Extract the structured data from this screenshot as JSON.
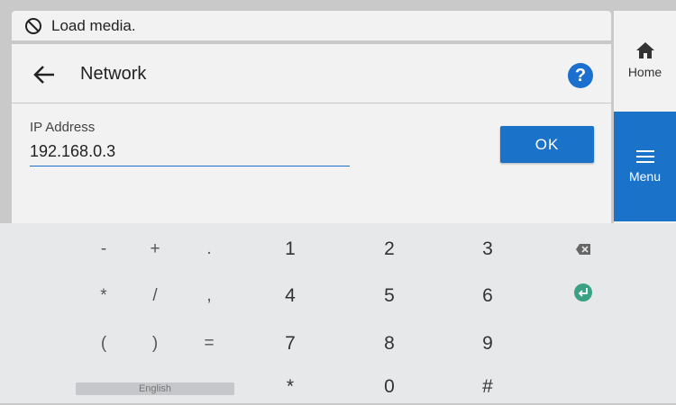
{
  "status": {
    "icon": "no-media-icon",
    "text": "Load media."
  },
  "header": {
    "title": "Network",
    "back_icon": "arrow-left-icon",
    "help_icon": "help-icon",
    "help_symbol": "?"
  },
  "form": {
    "label": "IP Address",
    "value": "192.168.0.3",
    "ok_label": "OK"
  },
  "sidebar": {
    "home": {
      "icon": "home-icon",
      "label": "Home"
    },
    "menu": {
      "icon": "hamburger-icon",
      "label": "Menu"
    }
  },
  "keyboard": {
    "language": "English",
    "symbols": [
      "-",
      "+",
      ".",
      "*",
      "/",
      ",",
      "(",
      ")",
      "="
    ],
    "numbers": [
      "1",
      "2",
      "3",
      "4",
      "5",
      "6",
      "7",
      "8",
      "9",
      "*",
      "0",
      "#"
    ]
  },
  "colors": {
    "accent": "#1a72c9",
    "enter_key": "#3aa184"
  }
}
